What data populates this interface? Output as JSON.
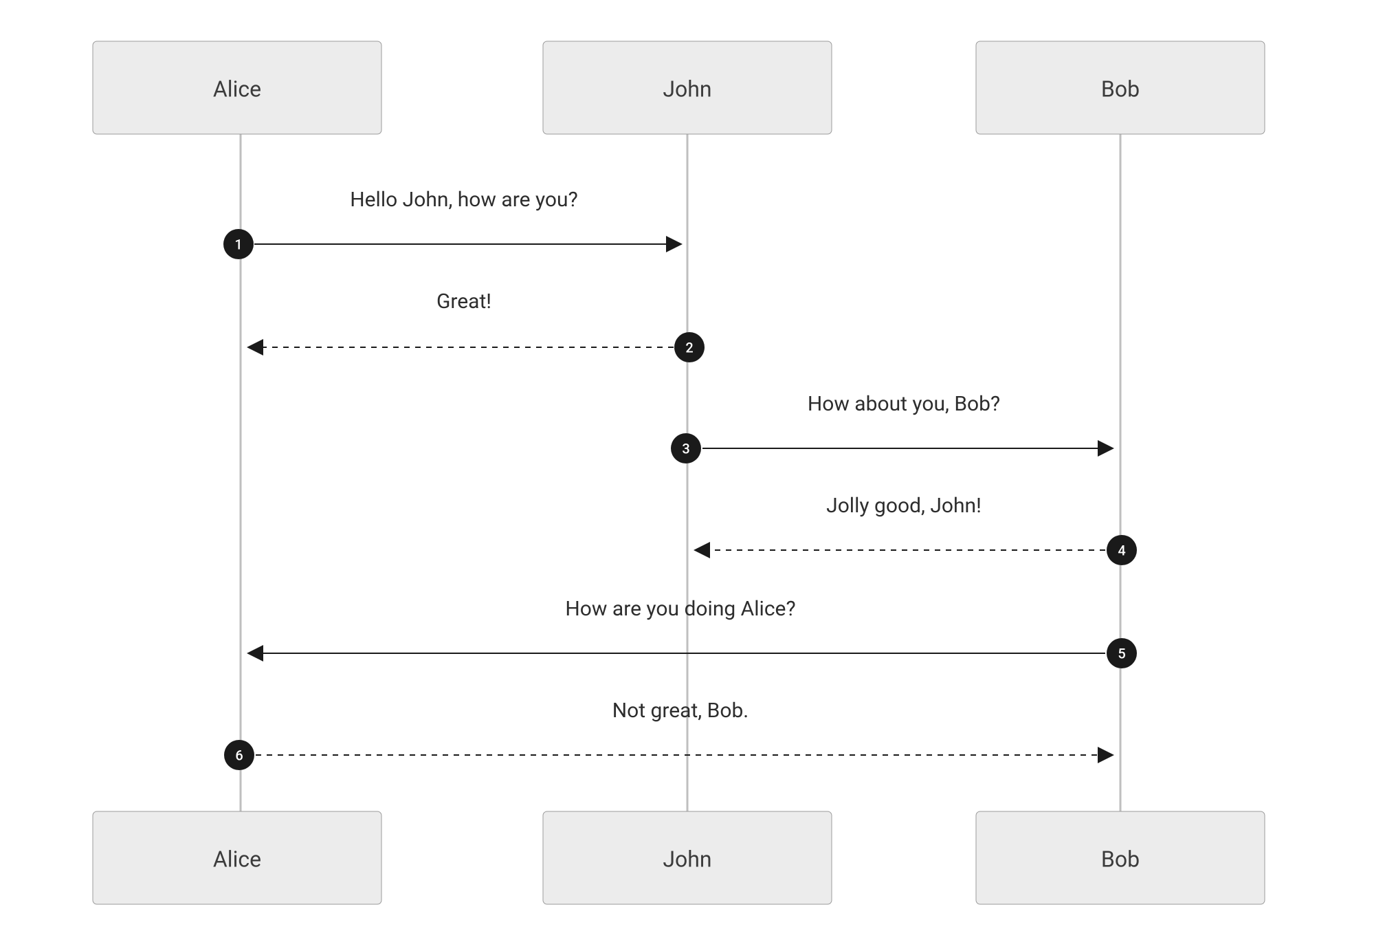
{
  "actors": {
    "alice": "Alice",
    "john": "John",
    "bob": "Bob"
  },
  "messages": {
    "m1": {
      "seq": "1",
      "text": "Hello John, how are you?"
    },
    "m2": {
      "seq": "2",
      "text": "Great!"
    },
    "m3": {
      "seq": "3",
      "text": "How about you, Bob?"
    },
    "m4": {
      "seq": "4",
      "text": "Jolly good, John!"
    },
    "m5": {
      "seq": "5",
      "text": "How are you doing Alice?"
    },
    "m6": {
      "seq": "6",
      "text": "Not great, Bob."
    }
  },
  "diagram_data": {
    "type": "sequence",
    "participants": [
      "Alice",
      "John",
      "Bob"
    ],
    "interactions": [
      {
        "seq": 1,
        "from": "Alice",
        "to": "John",
        "text": "Hello John, how are you?",
        "style": "solid"
      },
      {
        "seq": 2,
        "from": "John",
        "to": "Alice",
        "text": "Great!",
        "style": "dashed"
      },
      {
        "seq": 3,
        "from": "John",
        "to": "Bob",
        "text": "How about you, Bob?",
        "style": "solid"
      },
      {
        "seq": 4,
        "from": "Bob",
        "to": "John",
        "text": "Jolly good, John!",
        "style": "dashed"
      },
      {
        "seq": 5,
        "from": "Bob",
        "to": "Alice",
        "text": "How are you doing Alice?",
        "style": "solid"
      },
      {
        "seq": 6,
        "from": "Alice",
        "to": "Bob",
        "text": "Not great, Bob.",
        "style": "dashed"
      }
    ]
  }
}
